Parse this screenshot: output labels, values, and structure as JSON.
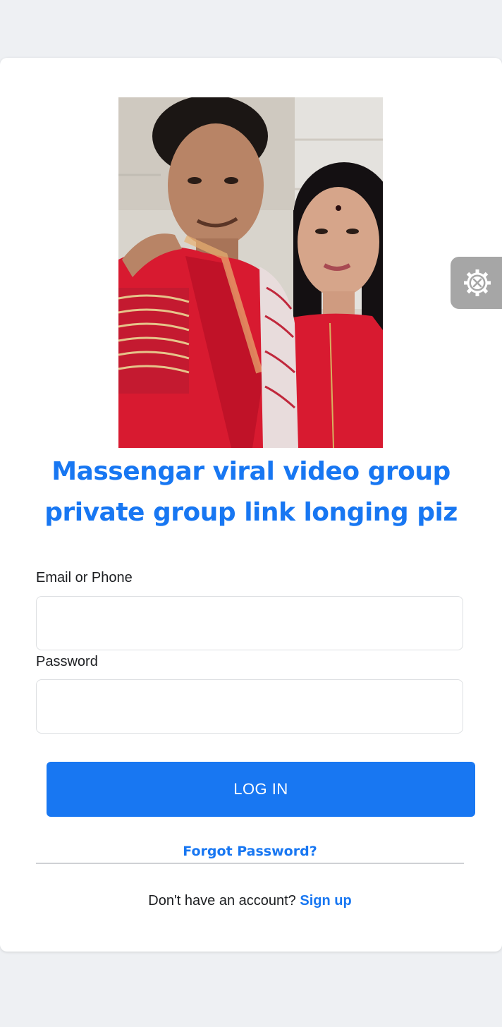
{
  "headline": {
    "line1": "Massengar viral video group",
    "line2": "private group link longing piz"
  },
  "photo": {
    "icon": "photo-of-couple"
  },
  "form": {
    "email_label": "Email or Phone",
    "email_value": "",
    "password_label": "Password",
    "password_value": "",
    "login_label": "LOG IN"
  },
  "links": {
    "forgot_password": "Forgot Password?",
    "no_account_text": "Don't have an account?",
    "signup_label": "Sign up"
  },
  "floating": {
    "settings_icon": "gear-wrench-icon"
  },
  "colors": {
    "accent": "#1877f2",
    "page_bg": "#eef0f3",
    "fab_bg": "#a6a6a6"
  }
}
